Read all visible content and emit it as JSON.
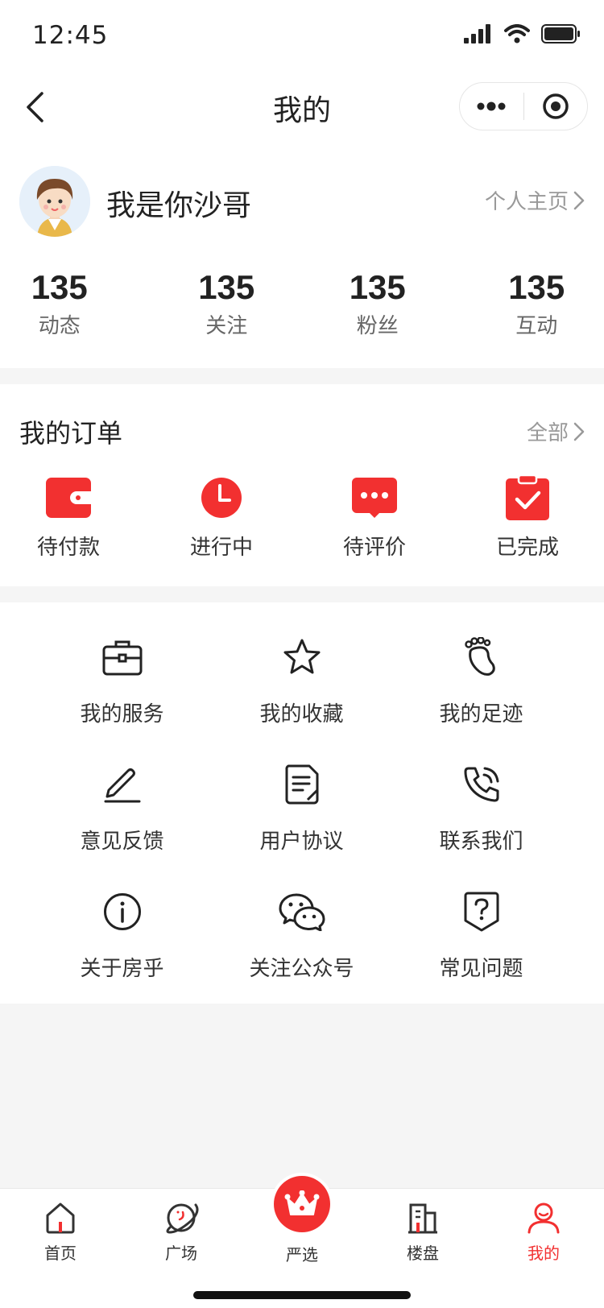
{
  "status_bar": {
    "time": "12:45"
  },
  "nav": {
    "title": "我的"
  },
  "profile": {
    "username": "我是你沙哥",
    "home_link": "个人主页",
    "stats": [
      {
        "value": "135",
        "label": "动态"
      },
      {
        "value": "135",
        "label": "关注"
      },
      {
        "value": "135",
        "label": "粉丝"
      },
      {
        "value": "135",
        "label": "互动"
      }
    ]
  },
  "orders": {
    "title": "我的订单",
    "all_label": "全部",
    "items": [
      {
        "label": "待付款",
        "icon": "wallet-icon"
      },
      {
        "label": "进行中",
        "icon": "clock-icon"
      },
      {
        "label": "待评价",
        "icon": "comment-icon"
      },
      {
        "label": "已完成",
        "icon": "clipboard-check-icon"
      }
    ]
  },
  "services": {
    "items": [
      {
        "label": "我的服务",
        "icon": "briefcase-icon"
      },
      {
        "label": "我的收藏",
        "icon": "star-icon"
      },
      {
        "label": "我的足迹",
        "icon": "footprint-icon"
      },
      {
        "label": "意见反馈",
        "icon": "pencil-icon"
      },
      {
        "label": "用户协议",
        "icon": "document-icon"
      },
      {
        "label": "联系我们",
        "icon": "phone-icon"
      },
      {
        "label": "关于房乎",
        "icon": "info-icon"
      },
      {
        "label": "关注公众号",
        "icon": "wechat-icon"
      },
      {
        "label": "常见问题",
        "icon": "question-shield-icon"
      }
    ]
  },
  "tab_bar": {
    "items": [
      {
        "label": "首页",
        "icon": "home-icon"
      },
      {
        "label": "广场",
        "icon": "planet-icon"
      },
      {
        "label": "严选",
        "icon": "crown-icon"
      },
      {
        "label": "楼盘",
        "icon": "building-icon"
      },
      {
        "label": "我的",
        "icon": "user-icon"
      }
    ],
    "active_index": 4
  },
  "colors": {
    "accent": "#f23030",
    "text": "#222222",
    "muted": "#999999",
    "background": "#f5f5f5"
  }
}
